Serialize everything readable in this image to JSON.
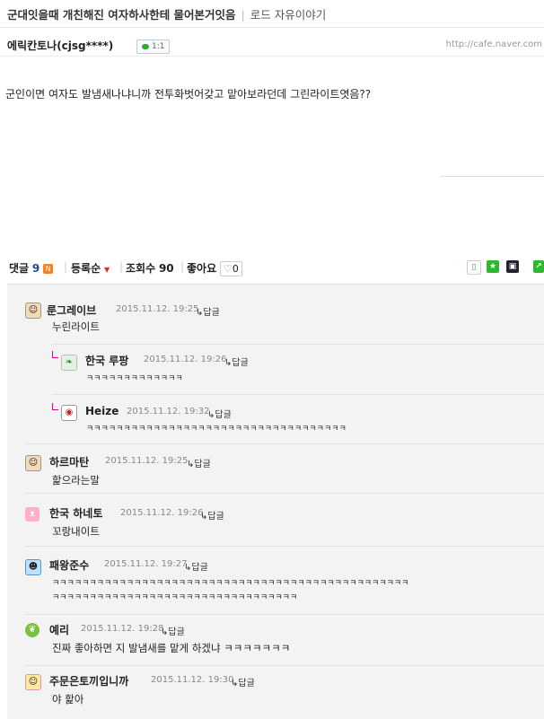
{
  "post": {
    "title": "군대잇을때 개친해진 여자하사한테 물어본거잇음",
    "board": "로드 자유이야기",
    "author": "에릭칸토나(cjsg****)",
    "talk_label": "1:1",
    "url": "http://cafe.naver.com",
    "body": "군인이면 여자도 발냄새나냐니까 전투화벗어갖고 맡아보라던데 그린라이트엿음??"
  },
  "comment_bar": {
    "label": "댓글",
    "count": "9",
    "rss_icon": "N",
    "sort": "등록순",
    "views_label": "조회수",
    "views": "90",
    "likes_label": "좋아요",
    "likes": "0"
  },
  "comments": [
    {
      "name": "룬그레이브",
      "date": "2015.11.12. 19:25",
      "reply": "답글",
      "text": "누린라이트",
      "level": 0,
      "avatar": "face-icon"
    },
    {
      "name": "한국 루팡",
      "date": "2015.11.12. 19:26",
      "reply": "답글",
      "text": "ㅋㅋㅋㅋㅋㅋㅋㅋㅋㅋㅋㅋㅋ",
      "level": 1,
      "avatar": "leaf-icon"
    },
    {
      "name": "Heize",
      "date": "2015.11.12. 19:32",
      "reply": "답글",
      "text": "ㅋㅋㅋㅋㅋㅋㅋㅋㅋㅋㅋㅋㅋㅋㅋㅋㅋㅋㅋㅋㅋㅋㅋㅋㅋㅋㅋㅋㅋㅋㅋㅋㅋㅋㅋ",
      "level": 1,
      "avatar": "glasses-face-icon"
    },
    {
      "name": "하르마탄",
      "date": "2015.11.12. 19:25",
      "reply": "답글",
      "text": "핥으라는말",
      "level": 0,
      "avatar": "face-icon"
    },
    {
      "name": "한국 하네토",
      "date": "2015.11.12. 19:26",
      "reply": "답글",
      "text": "꼬랑내이트",
      "level": 0,
      "avatar": "cat-icon"
    },
    {
      "name": "패왕준수",
      "date": "2015.11.12. 19:27",
      "reply": "답글",
      "text": "ㅋㅋㅋㅋㅋㅋㅋㅋㅋㅋㅋㅋㅋㅋㅋㅋㅋㅋㅋㅋㅋㅋㅋㅋㅋㅋㅋㅋㅋㅋㅋㅋㅋㅋㅋㅋㅋㅋㅋㅋㅋㅋㅋㅋㅋㅋㅋㅋ",
      "text2": "ㅋㅋㅋㅋㅋㅋㅋㅋㅋㅋㅋㅋㅋㅋㅋㅋㅋㅋㅋㅋㅋㅋㅋㅋㅋㅋㅋㅋㅋㅋㅋㅋㅋ",
      "level": 0,
      "avatar": "blue-face-icon"
    },
    {
      "name": "예리",
      "date": "2015.11.12. 19:28",
      "reply": "답글",
      "text": "진짜 좋아하면 지 발냄새를 맡게 하겠냐 ㅋㅋㅋㅋㅋㅋㅋ",
      "level": 0,
      "avatar": "green-leaf-icon"
    },
    {
      "name": "주문은토끼입니까",
      "date": "2015.11.12. 19:30",
      "reply": "답글",
      "text": "야 핥아",
      "level": 0,
      "avatar": "girl-face-icon"
    }
  ],
  "colors": {
    "accent": "#1e4b8f",
    "rss": "#f58220",
    "background": "#f3f3f3"
  }
}
